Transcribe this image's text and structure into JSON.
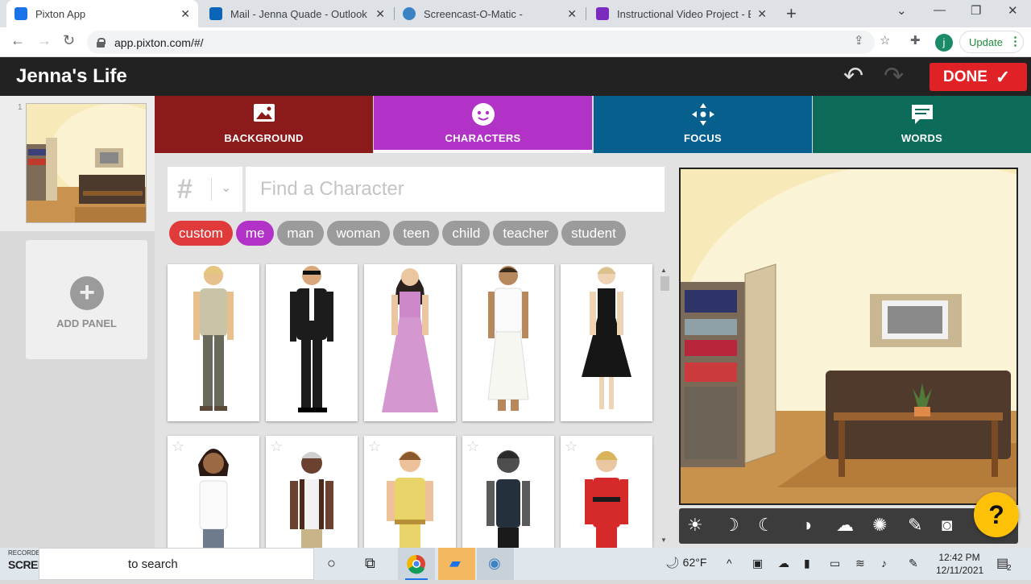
{
  "browser": {
    "tabs": [
      {
        "title": "Pixton App",
        "color": "#1a73e8",
        "active": true
      },
      {
        "title": "Mail - Jenna Quade - Outlook",
        "color": "#0a64b8",
        "active": false
      },
      {
        "title": "Screencast-O-Matic -",
        "color": "#3b82c4",
        "active": false
      },
      {
        "title": "Instructional Video Project - ELEI",
        "color": "#7b2cbf",
        "active": false
      }
    ],
    "url": "app.pixton.com/#/",
    "update_label": "Update",
    "profile_initial": "j"
  },
  "app": {
    "title": "Jenna's Life",
    "done_label": "DONE"
  },
  "sidebar": {
    "panel_number": "1",
    "add_panel_label": "ADD PANEL"
  },
  "editor_tabs": [
    {
      "label": "BACKGROUND",
      "color": "#8b1a1a",
      "icon": "image-icon",
      "active": false
    },
    {
      "label": "CHARACTERS",
      "color": "#b232c7",
      "icon": "face-icon",
      "active": true
    },
    {
      "label": "FOCUS",
      "color": "#075f8d",
      "icon": "move-icon",
      "active": false
    },
    {
      "label": "WORDS",
      "color": "#0d6b5a",
      "icon": "speech-icon",
      "active": false
    }
  ],
  "character_browser": {
    "number_filter": "#",
    "search_placeholder": "Find a Character",
    "chips": [
      {
        "label": "custom",
        "color": "#e03a3a"
      },
      {
        "label": "me",
        "color": "#b232c7"
      },
      {
        "label": "man",
        "color": "#9b9b9b"
      },
      {
        "label": "woman",
        "color": "#9b9b9b"
      },
      {
        "label": "teen",
        "color": "#9b9b9b"
      },
      {
        "label": "child",
        "color": "#9b9b9b"
      },
      {
        "label": "teacher",
        "color": "#9b9b9b"
      },
      {
        "label": "student",
        "color": "#9b9b9b"
      }
    ]
  },
  "canvas_toolbar": [
    "sun-icon",
    "moon-icon",
    "crescent-icon",
    "contrast-icon",
    "rain-icon",
    "swirl-icon",
    "brush-icon",
    "camera-icon"
  ],
  "help_label": "?",
  "taskbar": {
    "recorded_label": "RECORDED WITH",
    "brand_label": "SCREENCAST-O-MATIC",
    "search_text": "to search",
    "weather": "62°F",
    "time": "12:42 PM",
    "date": "12/11/2021",
    "notif_count": "2"
  }
}
